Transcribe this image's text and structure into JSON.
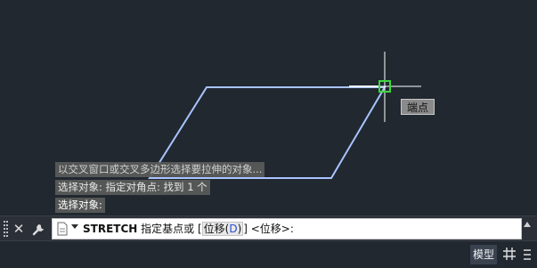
{
  "canvas": {
    "background": "#212830",
    "shape_color": "#a9c4ff",
    "osnap_color": "#3cd83c",
    "crosshair_color": "#ffffff",
    "snap_tooltip": "端点"
  },
  "command_history": [
    "以交叉窗口或交叉多边形选择要拉伸的对象...",
    "选择对象: 指定对角点: 找到 1 个",
    "选择对象:"
  ],
  "command_line": {
    "close_icon": "close-icon",
    "customize_icon": "wrench-icon",
    "command_name": "STRETCH",
    "prompt_text": " 指定基点或 [",
    "option_label": "位移(",
    "option_key": "D",
    "option_close": ")",
    "prompt_tail": "] <位移>:"
  },
  "status_bar": {
    "model_tab": "模型",
    "grid_icon": "grid-icon",
    "menu_icon": "menu-icon"
  }
}
